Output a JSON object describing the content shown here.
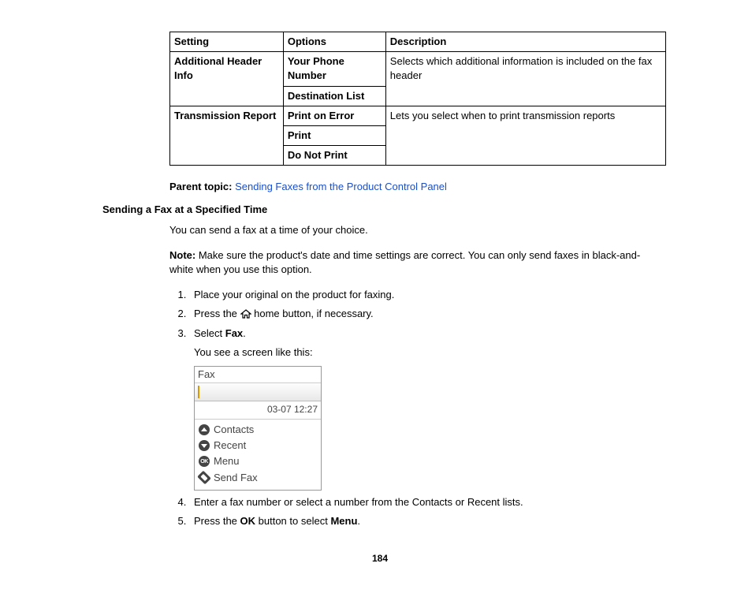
{
  "table": {
    "headers": [
      "Setting",
      "Options",
      "Description"
    ],
    "rows": {
      "r1_setting": "Additional Header Info",
      "r1_opt1": "Your Phone Number",
      "r1_opt2": "Destination List",
      "r1_desc": "Selects which additional information is included on the fax header",
      "r2_setting": "Transmission Report",
      "r2_opt1": "Print on Error",
      "r2_opt2": "Print",
      "r2_opt3": "Do Not Print",
      "r2_desc": "Lets you select when to print transmission reports"
    }
  },
  "parent_topic": {
    "label": "Parent topic:",
    "link": "Sending Faxes from the Product Control Panel"
  },
  "subhead": "Sending a Fax at a Specified Time",
  "intro": "You can send a fax at a time of your choice.",
  "note_label": "Note:",
  "note_text": " Make sure the product's date and time settings are correct. You can only send faxes in black-and-white when you use this option.",
  "steps": {
    "s1": "Place your original on the product for faxing.",
    "s2a": "Press the ",
    "s2b": " home button, if necessary.",
    "s3a": "Select ",
    "s3b": "Fax",
    "s3c": ".",
    "s3_sub": "You see a screen like this:",
    "s4": "Enter a fax number or select a number from the Contacts or Recent lists.",
    "s5a": "Press the ",
    "s5b": "OK",
    "s5c": " button to select ",
    "s5d": "Menu",
    "s5e": "."
  },
  "screenshot": {
    "title": "Fax",
    "datetime": "03-07 12:27",
    "menu": {
      "contacts": "Contacts",
      "recent": "Recent",
      "menu": "Menu",
      "send": "Send Fax"
    }
  },
  "page_number": "184"
}
